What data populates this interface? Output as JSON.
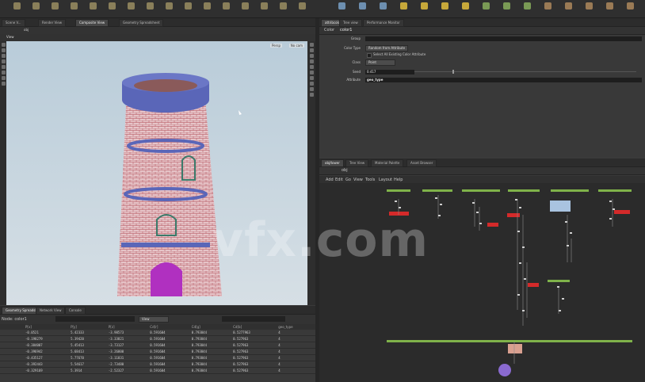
{
  "watermark": "vfx.com",
  "viewport": {
    "tab_labels": [
      "Scene V...",
      "Render View",
      "Composite View",
      "Geometry Spreadsheet"
    ],
    "path_label": "obj",
    "pane_title": "View",
    "top_right": [
      "Persp",
      "No cam"
    ]
  },
  "params": {
    "tab_labels": [
      "attribcolor1",
      "Tree view",
      "Performance Monitor"
    ],
    "node_name": "color1",
    "node_type_label": "Color",
    "rows": [
      {
        "label": "Group",
        "value": ""
      },
      {
        "label": "Class",
        "value": "Point"
      },
      {
        "label": "Color Type",
        "value": "Random from Attribute"
      },
      {
        "label": "Seed",
        "value": "0.417"
      },
      {
        "label": "Attribute",
        "value": "geo_type"
      }
    ],
    "checkbox_label": "Select All Existing Color Attribute"
  },
  "network": {
    "tab_labels": [
      "obj/tower",
      "Tree View",
      "Material Palette",
      "Asset Browser"
    ],
    "menu": [
      "Add",
      "Edit",
      "Go",
      "View",
      "Tools",
      "Layout",
      "Help"
    ],
    "path_label": "obj"
  },
  "spreadsheet": {
    "tab_labels": [
      "Geometry Spreadsheet",
      "Network View",
      "Console"
    ],
    "node_label": "Node: color1",
    "view_label": "View",
    "columns": [
      "P[x]",
      "P[y]",
      "P[z]",
      "Cd[r]",
      "Cd[g]",
      "Cd[b]",
      "geo_type"
    ],
    "rows": [
      [
        "-0.0521",
        "5.42333",
        "-3.98573",
        "0.591604",
        "0.793844",
        "0.5277963",
        "4"
      ],
      [
        "-0.198279",
        "5.39420",
        "-3.33821",
        "0.591604",
        "0.793844",
        "0.527963",
        "4"
      ],
      [
        "-0.384007",
        "5.45413",
        "-3.73127",
        "0.591604",
        "0.793844",
        "0.527963",
        "4"
      ],
      [
        "-0.396942",
        "5.68413",
        "-3.26800",
        "0.591604",
        "0.793844",
        "0.527963",
        "4"
      ],
      [
        "-0.435127",
        "5.77670",
        "-3.11831",
        "0.591604",
        "0.793844",
        "0.527963",
        "4"
      ],
      [
        "-0.392443",
        "5.54617",
        "-2.73480",
        "0.591604",
        "0.793844",
        "0.527963",
        "4"
      ],
      [
        "-0.329169",
        "5.3914",
        "-2.52327",
        "0.591604",
        "0.793844",
        "0.527963",
        "4"
      ]
    ]
  },
  "colors": {
    "network_green": "#7fb24a",
    "network_red": "#d42a2a",
    "tower_blue": "#5a66b8",
    "door_magenta": "#b030c0"
  }
}
